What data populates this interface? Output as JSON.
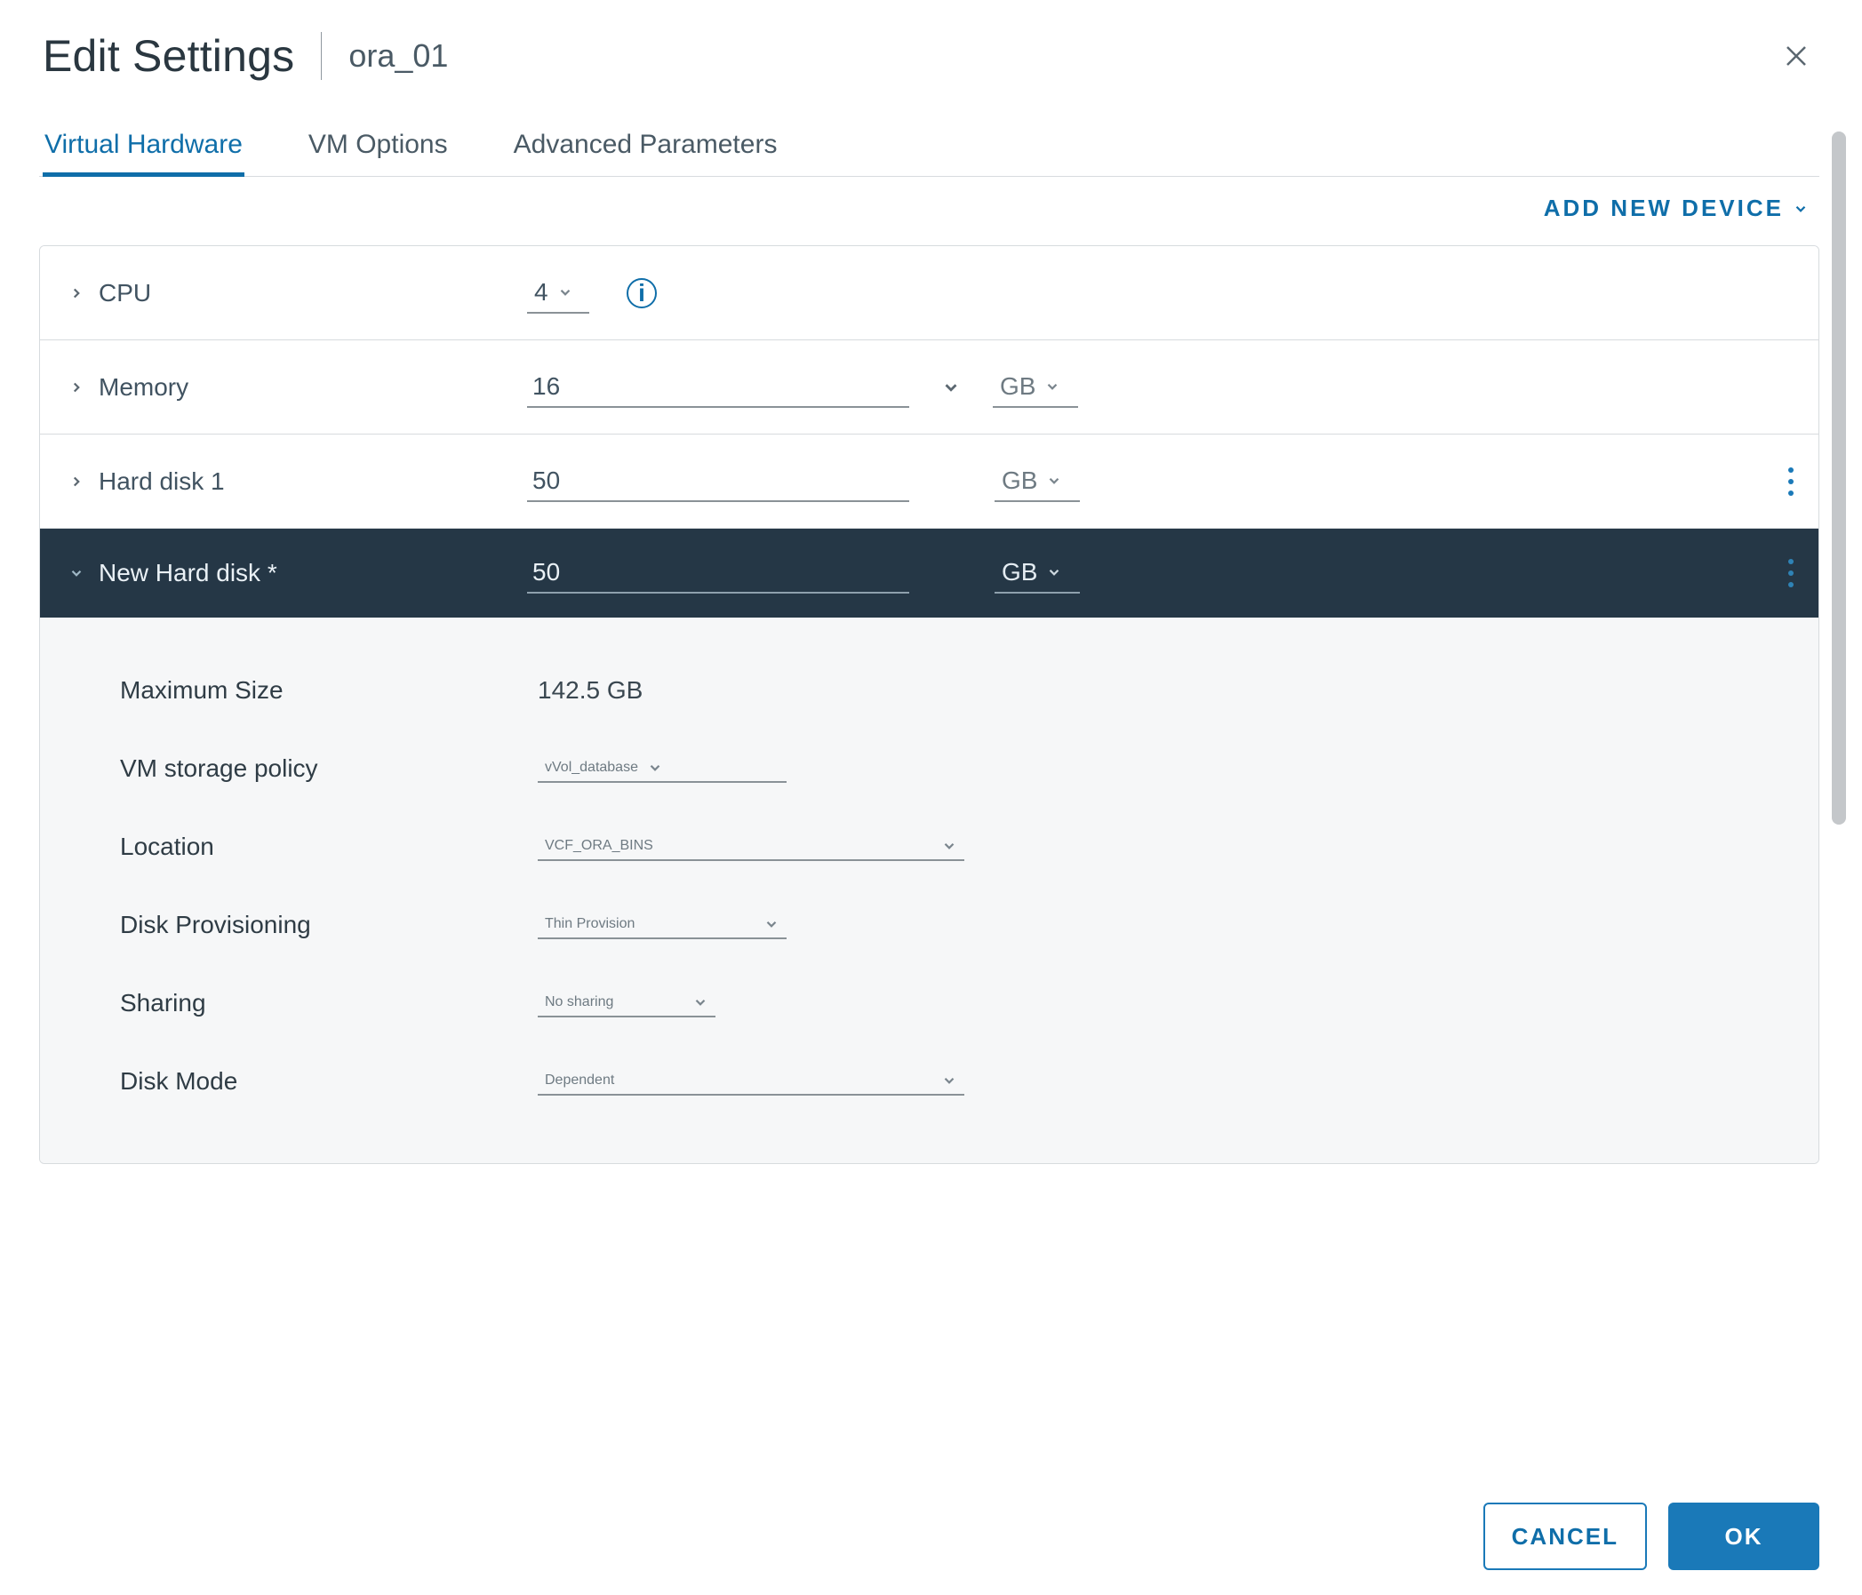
{
  "header": {
    "title": "Edit Settings",
    "vm_name": "ora_01"
  },
  "tabs": {
    "virtual_hardware": "Virtual Hardware",
    "vm_options": "VM Options",
    "advanced_parameters": "Advanced Parameters"
  },
  "actions": {
    "add_new_device": "ADD NEW DEVICE"
  },
  "hardware": {
    "cpu": {
      "label": "CPU",
      "value": "4"
    },
    "memory": {
      "label": "Memory",
      "value": "16",
      "unit": "GB"
    },
    "hard_disk_1": {
      "label": "Hard disk 1",
      "value": "50",
      "unit": "GB"
    },
    "new_hard_disk": {
      "label": "New Hard disk *",
      "value": "50",
      "unit": "GB",
      "details": {
        "max_size_label": "Maximum Size",
        "max_size_value": "142.5 GB",
        "storage_policy_label": "VM storage policy",
        "storage_policy_value": "vVol_database",
        "location_label": "Location",
        "location_value": "VCF_ORA_BINS",
        "provisioning_label": "Disk Provisioning",
        "provisioning_value": "Thin Provision",
        "sharing_label": "Sharing",
        "sharing_value": "No sharing",
        "disk_mode_label": "Disk Mode",
        "disk_mode_value": "Dependent"
      }
    }
  },
  "footer": {
    "cancel": "CANCEL",
    "ok": "OK"
  },
  "colors": {
    "brand": "#1a79b8",
    "row_dark": "#253746"
  }
}
